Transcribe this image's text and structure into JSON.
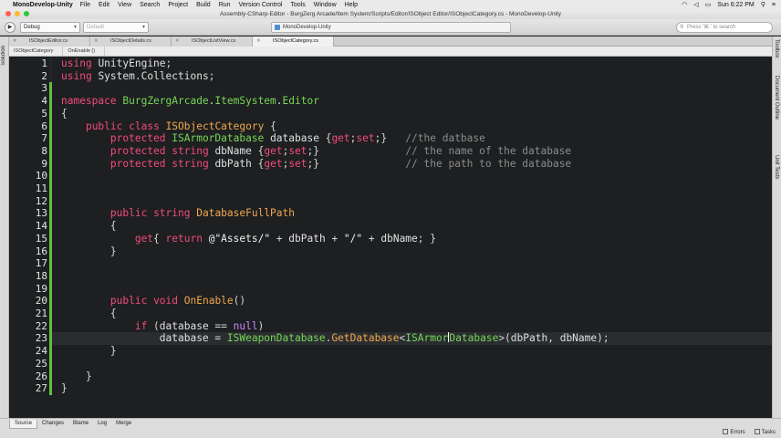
{
  "menubar": {
    "app_name": "MonoDevelop-Unity",
    "items": [
      "File",
      "Edit",
      "View",
      "Search",
      "Project",
      "Build",
      "Run",
      "Version Control",
      "Tools",
      "Window",
      "Help"
    ],
    "clock": "Sun 6:22 PM"
  },
  "window": {
    "title": "Assembly-CSharp-Editor - BurgZerg Arcade/Item System/Scripts/Editor/ISObject Editor/ISObjectCategory.cs - MonoDevelop-Unity"
  },
  "toolbar": {
    "config": "Debug",
    "target": "Default",
    "status": "MonoDevelop-Unity",
    "search_placeholder": "Press '⌘.' to search"
  },
  "left_pad": "Solution",
  "right_pads": [
    "Toolbox",
    "Document Outline",
    "Unit Tests"
  ],
  "tabs": [
    {
      "label": "ISObjectEditor.cs",
      "active": false
    },
    {
      "label": "ISObjectDetails.cs",
      "active": false
    },
    {
      "label": "ISObjectListView.cs",
      "active": false
    },
    {
      "label": "ISObjectCategory.cs",
      "active": true
    }
  ],
  "breadcrumb": [
    "ISObjectCategory",
    "OnEnable ()"
  ],
  "code": {
    "current_line": 23,
    "lines": [
      {
        "n": "1",
        "text": "using UnityEngine;"
      },
      {
        "n": "2",
        "text": "using System.Collections;"
      },
      {
        "n": "3",
        "text": ""
      },
      {
        "n": "4",
        "text": "namespace BurgZergArcade.ItemSystem.Editor"
      },
      {
        "n": "5",
        "text": "{"
      },
      {
        "n": "6",
        "text": "    public class ISObjectCategory {"
      },
      {
        "n": "7",
        "text": "        protected ISArmorDatabase database {get;set;}   //the datbase"
      },
      {
        "n": "8",
        "text": "        protected string dbName {get;set;}              // the name of the database"
      },
      {
        "n": "9",
        "text": "        protected string dbPath {get;set;}              // the path to the database"
      },
      {
        "n": "10",
        "text": ""
      },
      {
        "n": "11",
        "text": ""
      },
      {
        "n": "12",
        "text": ""
      },
      {
        "n": "13",
        "text": "        public string DatabaseFullPath"
      },
      {
        "n": "14",
        "text": "        {"
      },
      {
        "n": "15",
        "text": "            get{ return @\"Assets/\" + dbPath + \"/\" + dbName; }"
      },
      {
        "n": "16",
        "text": "        }"
      },
      {
        "n": "17",
        "text": ""
      },
      {
        "n": "18",
        "text": ""
      },
      {
        "n": "19",
        "text": ""
      },
      {
        "n": "20",
        "text": "        public void OnEnable()"
      },
      {
        "n": "21",
        "text": "        {"
      },
      {
        "n": "22",
        "text": "            if (database == null)"
      },
      {
        "n": "23",
        "text": "                database = ISWeaponDatabase.GetDatabase<ISArmorDatabase>(dbPath, dbName);"
      },
      {
        "n": "24",
        "text": "        }"
      },
      {
        "n": "25",
        "text": ""
      },
      {
        "n": "26",
        "text": "    }"
      },
      {
        "n": "27",
        "text": "}"
      }
    ]
  },
  "bottom_tabs": [
    {
      "label": "Source",
      "active": true
    },
    {
      "label": "Changes",
      "active": false
    },
    {
      "label": "Blame",
      "active": false
    },
    {
      "label": "Log",
      "active": false
    },
    {
      "label": "Merge",
      "active": false
    }
  ],
  "status_pads": {
    "errors": "Errors",
    "tasks": "Tasks"
  },
  "colors": {
    "keyword": "#f34b7d",
    "type": "#f0a84d",
    "comment": "#8c8c8c",
    "editor_bg": "#1d1f21",
    "change_marker": "#5fbf3f"
  }
}
